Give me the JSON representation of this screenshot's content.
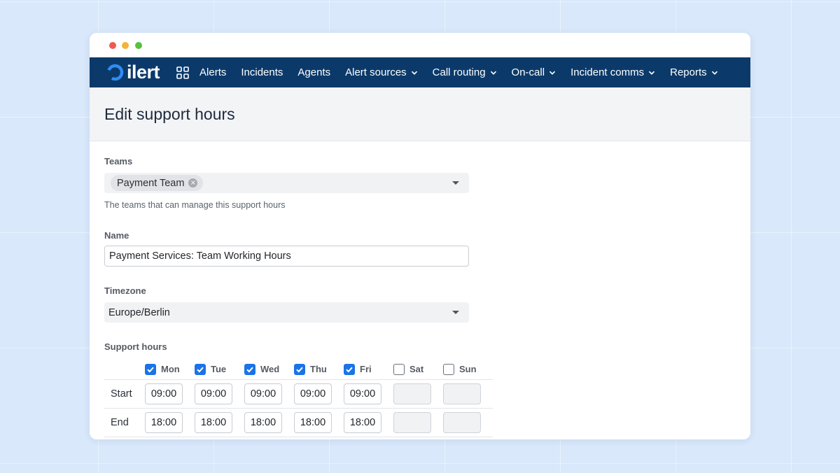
{
  "navbar": {
    "logo_text": "ilert",
    "items": [
      {
        "label": "Alerts",
        "dropdown": false
      },
      {
        "label": "Incidents",
        "dropdown": false
      },
      {
        "label": "Agents",
        "dropdown": false
      },
      {
        "label": "Alert sources",
        "dropdown": true
      },
      {
        "label": "Call routing",
        "dropdown": true
      },
      {
        "label": "On-call",
        "dropdown": true
      },
      {
        "label": "Incident comms",
        "dropdown": true
      },
      {
        "label": "Reports",
        "dropdown": true
      }
    ]
  },
  "page": {
    "title": "Edit support hours"
  },
  "form": {
    "teams": {
      "label": "Teams",
      "selected_chip": "Payment Team",
      "helper": "The teams that can manage this support hours"
    },
    "name": {
      "label": "Name",
      "value": "Payment Services: Team Working Hours"
    },
    "timezone": {
      "label": "Timezone",
      "value": "Europe/Berlin"
    },
    "support_hours": {
      "label": "Support hours",
      "row_labels": {
        "start": "Start",
        "end": "End"
      },
      "days": [
        {
          "label": "Mon",
          "checked": true,
          "start": "09:00",
          "end": "18:00"
        },
        {
          "label": "Tue",
          "checked": true,
          "start": "09:00",
          "end": "18:00"
        },
        {
          "label": "Wed",
          "checked": true,
          "start": "09:00",
          "end": "18:00"
        },
        {
          "label": "Thu",
          "checked": true,
          "start": "09:00",
          "end": "18:00"
        },
        {
          "label": "Fri",
          "checked": true,
          "start": "09:00",
          "end": "18:00"
        },
        {
          "label": "Sat",
          "checked": false,
          "start": "",
          "end": ""
        },
        {
          "label": "Sun",
          "checked": false,
          "start": "",
          "end": ""
        }
      ]
    }
  },
  "colors": {
    "navbar_bg": "#0b3a6a",
    "accent_blue": "#1a73e8",
    "logo_ring": "#2f8cf5"
  }
}
